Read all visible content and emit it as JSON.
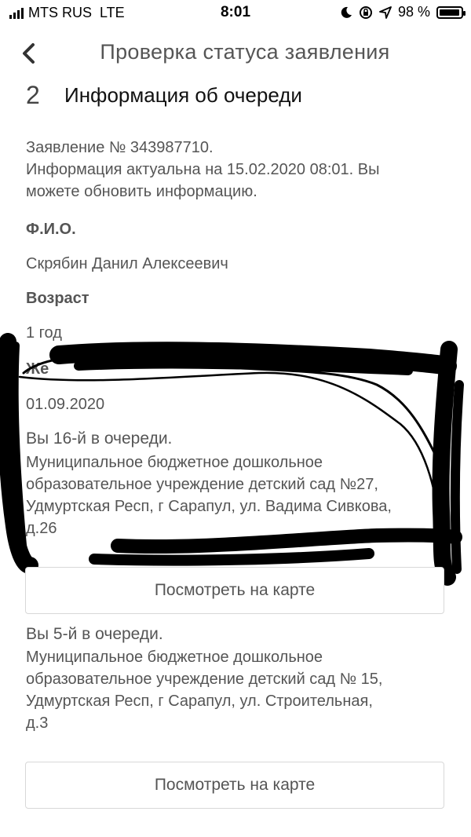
{
  "status_bar": {
    "carrier": "MTS RUS",
    "network": "LTE",
    "time": "8:01",
    "battery": "98 %",
    "battery_level": 0.98
  },
  "header": {
    "title": "Проверка статуса заявления"
  },
  "section": {
    "step": "2",
    "title": "Информация об очереди"
  },
  "application": {
    "number_line": "Заявление № 343987710.",
    "actuality_line1": "Информация актуальна на 15.02.2020 08:01. Вы",
    "actuality_line2": "можете обновить информацию."
  },
  "fields": {
    "fio_label": "Ф.И.О.",
    "fio_value": "Скрябин Данил Алексеевич",
    "age_label": "Возраст",
    "age_value": "1 год",
    "hidden_label": "Же",
    "date_value": "01.09.2020"
  },
  "queues": [
    {
      "position": "Вы 16-й в очереди.",
      "lines": [
        "Муниципальное бюджетное дошкольное",
        "образовательное учреждение детский сад №27,",
        "Удмуртская Респ, г Сарапул, ул. Вадима Сивкова,",
        "д.26"
      ],
      "button": "Посмотреть на карте"
    },
    {
      "position": "Вы 5-й в очереди.",
      "lines": [
        "Муниципальное бюджетное дошкольное",
        "образовательное учреждение детский сад № 15,",
        "Удмуртская Респ, г Сарапул, ул. Строительная,",
        "д.3"
      ],
      "button": "Посмотреть на карте"
    }
  ],
  "colors": {
    "text": "#555555",
    "scribble": "#000000",
    "button_border": "#d8d8d8"
  }
}
